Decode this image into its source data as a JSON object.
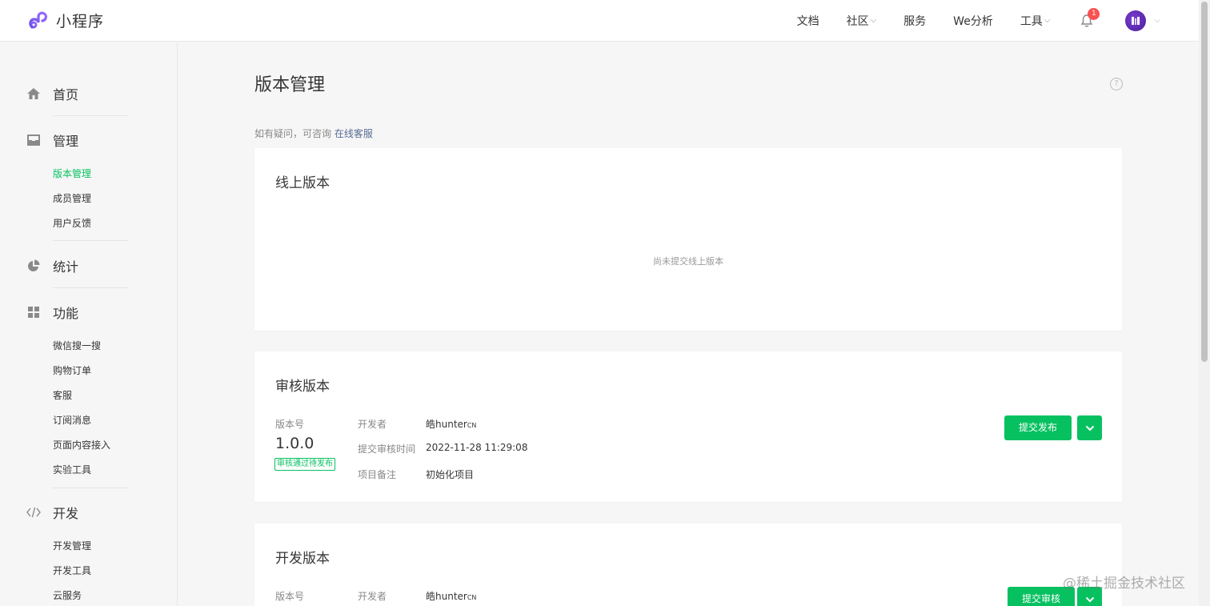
{
  "brand": {
    "name": "小程序"
  },
  "topnav": {
    "items": [
      {
        "label": "文档",
        "caret": false
      },
      {
        "label": "社区",
        "caret": true
      },
      {
        "label": "服务",
        "caret": false
      },
      {
        "label": "We分析",
        "caret": false
      },
      {
        "label": "工具",
        "caret": true
      }
    ],
    "notification_count": "1"
  },
  "sidebar": {
    "sections": [
      {
        "label": "首页",
        "icon": "home-icon",
        "items": []
      },
      {
        "label": "管理",
        "icon": "inbox-icon",
        "items": [
          "版本管理",
          "成员管理",
          "用户反馈"
        ],
        "active": "版本管理"
      },
      {
        "label": "统计",
        "icon": "pie-chart-icon",
        "items": []
      },
      {
        "label": "功能",
        "icon": "grid-icon",
        "items": [
          "微信搜一搜",
          "购物订单",
          "客服",
          "订阅消息",
          "页面内容接入",
          "实验工具"
        ]
      },
      {
        "label": "开发",
        "icon": "code-icon",
        "items": [
          "开发管理",
          "开发工具",
          "云服务"
        ]
      }
    ]
  },
  "main": {
    "title": "版本管理",
    "consult_text": "如有疑问，可咨询",
    "consult_link": "在线客服",
    "online": {
      "title": "线上版本",
      "empty_tip": "尚未提交线上版本"
    },
    "review": {
      "title": "审核版本",
      "version_label": "版本号",
      "version": "1.0.0",
      "status": "审核通过待发布",
      "developer_label": "开发者",
      "developer": "皓hunter",
      "developer_suffix": "CN",
      "submit_time_label": "提交审核时间",
      "submit_time": "2022-11-28 11:29:08",
      "remark_label": "项目备注",
      "remark": "初始化项目",
      "action": "提交发布"
    },
    "dev": {
      "title": "开发版本",
      "version_label": "版本号",
      "developer_label": "开发者",
      "developer": "皓hunter",
      "developer_suffix": "CN",
      "action": "提交审核"
    }
  },
  "watermark": "@稀土掘金技术社区",
  "colors": {
    "accent": "#07c160",
    "link": "#576b95",
    "badge": "#fa5151"
  }
}
